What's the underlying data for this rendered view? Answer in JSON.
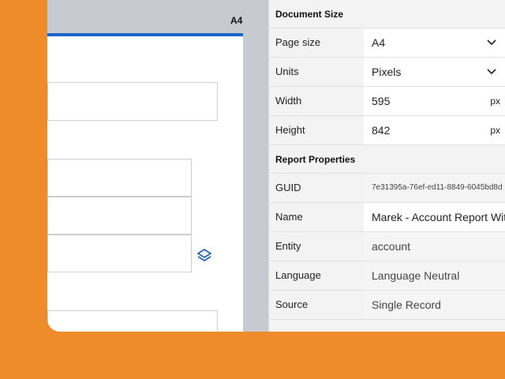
{
  "canvas": {
    "page_size_tag": "A4",
    "icon": "layers-icon"
  },
  "document_size": {
    "title": "Document Size",
    "page_size": {
      "label": "Page size",
      "value": "A4"
    },
    "units": {
      "label": "Units",
      "value": "Pixels"
    },
    "width": {
      "label": "Width",
      "value": "595",
      "unit": "px"
    },
    "height": {
      "label": "Height",
      "value": "842",
      "unit": "px"
    }
  },
  "report_properties": {
    "title": "Report Properties",
    "guid": {
      "label": "GUID",
      "value": "7e31395a-76ef-ed11-8849-6045bd8d"
    },
    "name": {
      "label": "Name",
      "value": "Marek - Account Report With"
    },
    "entity": {
      "label": "Entity",
      "value": "account"
    },
    "language": {
      "label": "Language",
      "value": "Language Neutral"
    },
    "source": {
      "label": "Source",
      "value": "Single Record"
    }
  },
  "colors": {
    "background": "#EE8C2C",
    "accent": "#1C64C5"
  }
}
